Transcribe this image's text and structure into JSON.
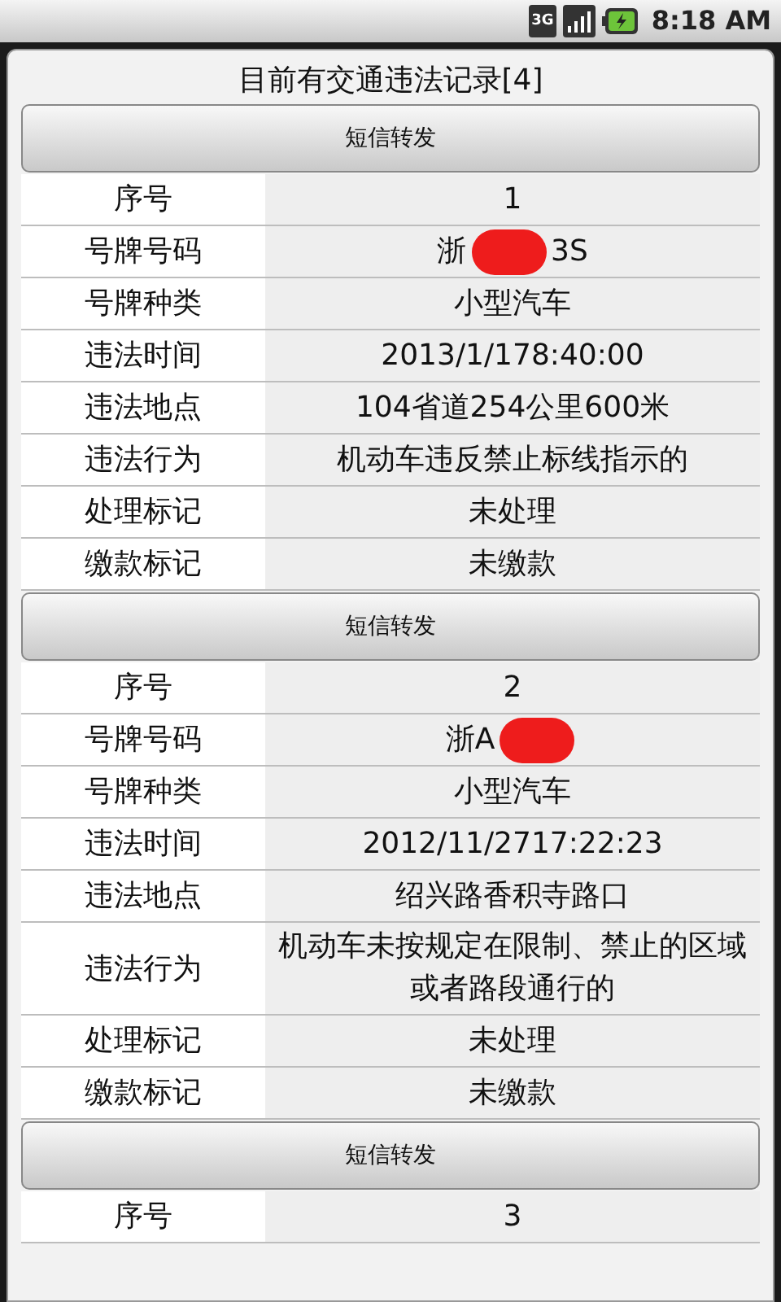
{
  "status_bar": {
    "network": "3G",
    "time": "8:18 AM"
  },
  "dialog": {
    "title": "目前有交通违法记录[4]"
  },
  "records": [
    {
      "button": "短信转发",
      "rows": [
        {
          "kind": "text",
          "label": "序号",
          "value": "1"
        },
        {
          "kind": "plate",
          "label": "号牌号码",
          "prefix": "浙",
          "suffix": "3S",
          "redacted": true
        },
        {
          "kind": "text",
          "label": "号牌种类",
          "value": "小型汽车"
        },
        {
          "kind": "text",
          "label": "违法时间",
          "value": "2013/1/178:40:00"
        },
        {
          "kind": "text",
          "label": "违法地点",
          "value": "104省道254公里600米"
        },
        {
          "kind": "text",
          "label": "违法行为",
          "value": "机动车违反禁止标线指示的"
        },
        {
          "kind": "text",
          "label": "处理标记",
          "value": "未处理"
        },
        {
          "kind": "text",
          "label": "缴款标记",
          "value": "未缴款"
        }
      ]
    },
    {
      "button": "短信转发",
      "rows": [
        {
          "kind": "text",
          "label": "序号",
          "value": "2"
        },
        {
          "kind": "plate",
          "label": "号牌号码",
          "prefix": "浙A",
          "redacted": true
        },
        {
          "kind": "text",
          "label": "号牌种类",
          "value": "小型汽车"
        },
        {
          "kind": "text",
          "label": "违法时间",
          "value": "2012/11/2717:22:23"
        },
        {
          "kind": "text",
          "label": "违法地点",
          "value": "绍兴路香积寺路口"
        },
        {
          "kind": "text",
          "label": "违法行为",
          "value": "机动车未按规定在限制、禁止的区域或者路段通行的"
        },
        {
          "kind": "text",
          "label": "处理标记",
          "value": "未处理"
        },
        {
          "kind": "text",
          "label": "缴款标记",
          "value": "未缴款"
        }
      ]
    },
    {
      "button": "短信转发",
      "rows": [
        {
          "kind": "text",
          "label": "序号",
          "value": "3"
        }
      ]
    }
  ]
}
